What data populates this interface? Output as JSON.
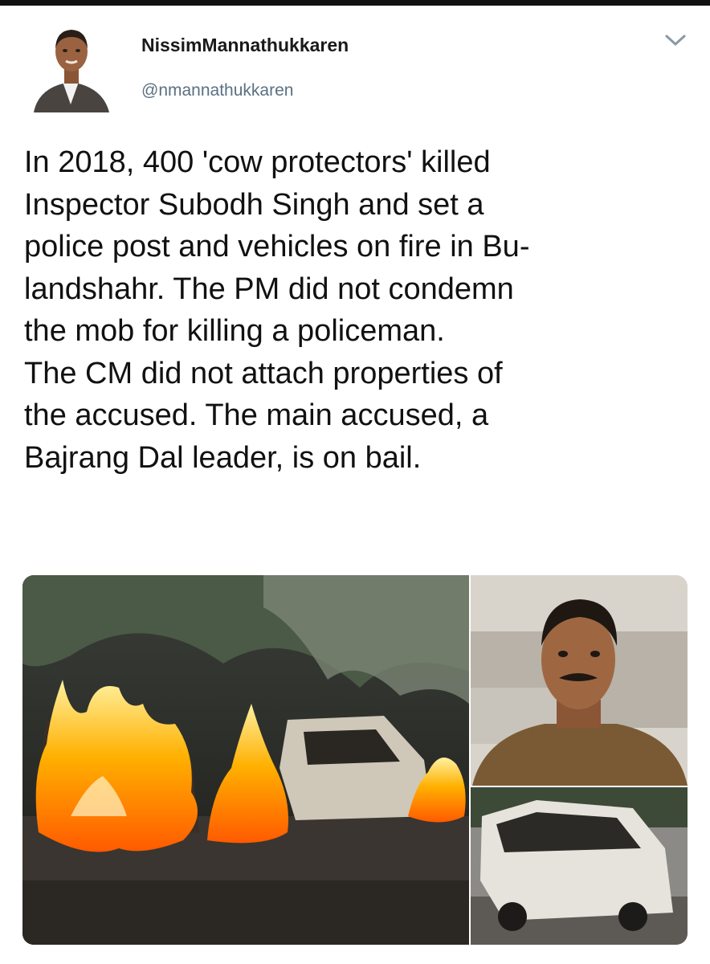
{
  "tweet": {
    "display_name": "NissimMannathukkaren",
    "handle": "@nmannathukkaren",
    "text": "In 2018, 400 'cow protectors' killed\nInspector Subodh Singh and set a\npolice post and vehicles on fire in Bu-\nlandshahr. The PM did not condemn\nthe mob for killing a policeman.\nThe CM did not attach properties of\nthe accused. The main accused, a\nBajrang Dal leader, is on bail."
  },
  "icons": {
    "menu": "chevron-down-icon",
    "avatar": "profile-photo"
  },
  "colors": {
    "text": "#111111",
    "handle": "#5b7083",
    "fire": "#ff8a00"
  }
}
